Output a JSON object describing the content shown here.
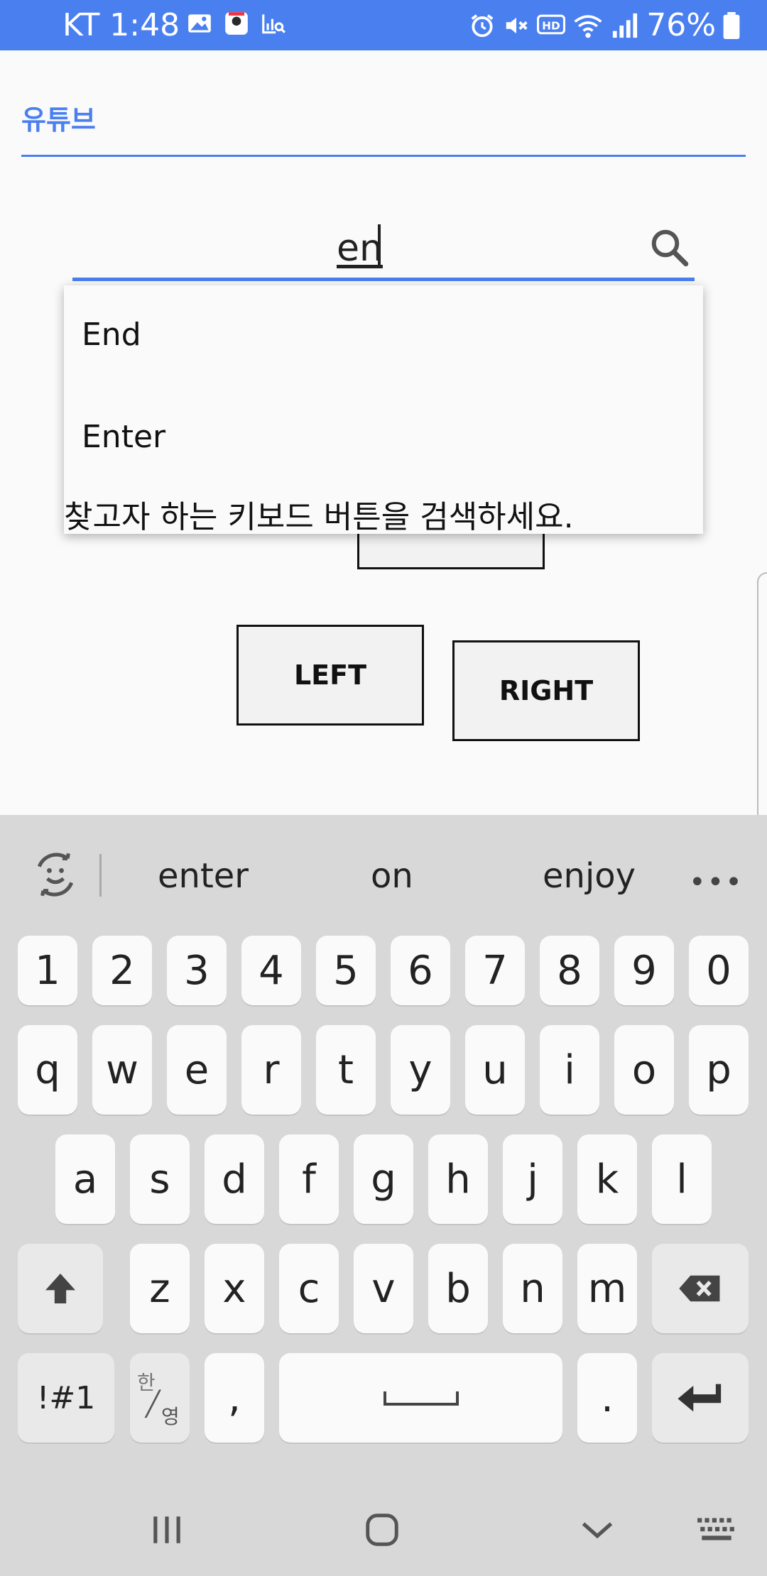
{
  "status_bar": {
    "carrier_time": "KT 1:48",
    "battery": "76%",
    "left_icons": [
      "gallery-icon",
      "map-app-icon",
      "chart-search-icon"
    ],
    "right_icons": [
      "alarm-icon",
      "mute-icon",
      "hd-icon",
      "wifi-icon",
      "signal-icon",
      "battery-icon"
    ]
  },
  "tab": {
    "label": "유튜브"
  },
  "search": {
    "value": "en"
  },
  "dropdown": {
    "items": [
      "End",
      "Enter"
    ],
    "hint": "찾고자 하는 키보드 버튼을 검색하세요."
  },
  "buttons": {
    "left": "LEFT",
    "right": "RIGHT"
  },
  "keyboard": {
    "suggestions": [
      "enter",
      "on",
      "enjoy"
    ],
    "more": "•••",
    "rows": {
      "numbers": [
        "1",
        "2",
        "3",
        "4",
        "5",
        "6",
        "7",
        "8",
        "9",
        "0"
      ],
      "row1": [
        "q",
        "w",
        "e",
        "r",
        "t",
        "y",
        "u",
        "i",
        "o",
        "p"
      ],
      "row2": [
        "a",
        "s",
        "d",
        "f",
        "g",
        "h",
        "j",
        "k",
        "l"
      ],
      "row3": [
        "z",
        "x",
        "c",
        "v",
        "b",
        "n",
        "m"
      ]
    },
    "symbols_key": "!#1",
    "lang_key_top": "한",
    "lang_key_bottom": "영",
    "comma_key": ",",
    "period_key": "."
  },
  "colors": {
    "accent": "#4a7ff0",
    "keyboard_bg": "#d8d8d8",
    "key_bg": "#fafafa"
  }
}
